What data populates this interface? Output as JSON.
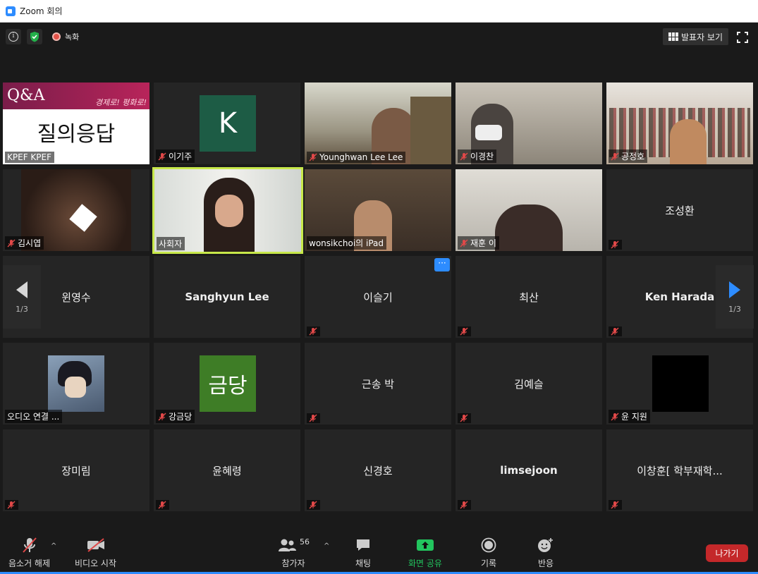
{
  "window": {
    "title": "Zoom 회의"
  },
  "topbar": {
    "recording_label": "녹화",
    "speaker_view_label": "발표자 보기"
  },
  "pager": {
    "left": "1/3",
    "right": "1/3"
  },
  "tiles": [
    {
      "name": "KPEF KPEF",
      "slide_title": "Q&A",
      "slide_banner": "경제로! 평화로!",
      "slide_body": "질의응답"
    },
    {
      "name": "이기주",
      "initial": "K"
    },
    {
      "name": "Younghwan Lee Lee"
    },
    {
      "name": "이경찬"
    },
    {
      "name": "공정호"
    },
    {
      "name": "김시엽"
    },
    {
      "name": "사회자"
    },
    {
      "name": "wonsikchoi의 iPad"
    },
    {
      "name": "재훈 이"
    },
    {
      "name": "조성환"
    },
    {
      "name": "윈영수"
    },
    {
      "name": "Sanghyun Lee"
    },
    {
      "name": "이슬기",
      "more": "···"
    },
    {
      "name": "최산"
    },
    {
      "name": "Ken Harada"
    },
    {
      "name": "오디오 연결 ..."
    },
    {
      "name": "강금당",
      "initial": "금당"
    },
    {
      "name": "근송 박"
    },
    {
      "name": "김예슬"
    },
    {
      "name": "윤 지원"
    },
    {
      "name": "장미림"
    },
    {
      "name": "윤혜령"
    },
    {
      "name": "신경호"
    },
    {
      "name": "limsejoon"
    },
    {
      "name": "이창훈[ 학부재학..."
    }
  ],
  "toolbar": {
    "unmute": "음소거 해제",
    "start_video": "비디오 시작",
    "participants": "참가자",
    "participant_count": "56",
    "chat": "채팅",
    "share_screen": "화면 공유",
    "record": "기록",
    "reactions": "반응",
    "leave": "나가기"
  },
  "colors": {
    "accent": "#2d8cff",
    "active_speaker": "#c7e84a",
    "share_green": "#22c55e",
    "leave_red": "#c4282a",
    "avatar_k": "#1d5c45",
    "avatar_geumdang": "#3e7d26"
  }
}
